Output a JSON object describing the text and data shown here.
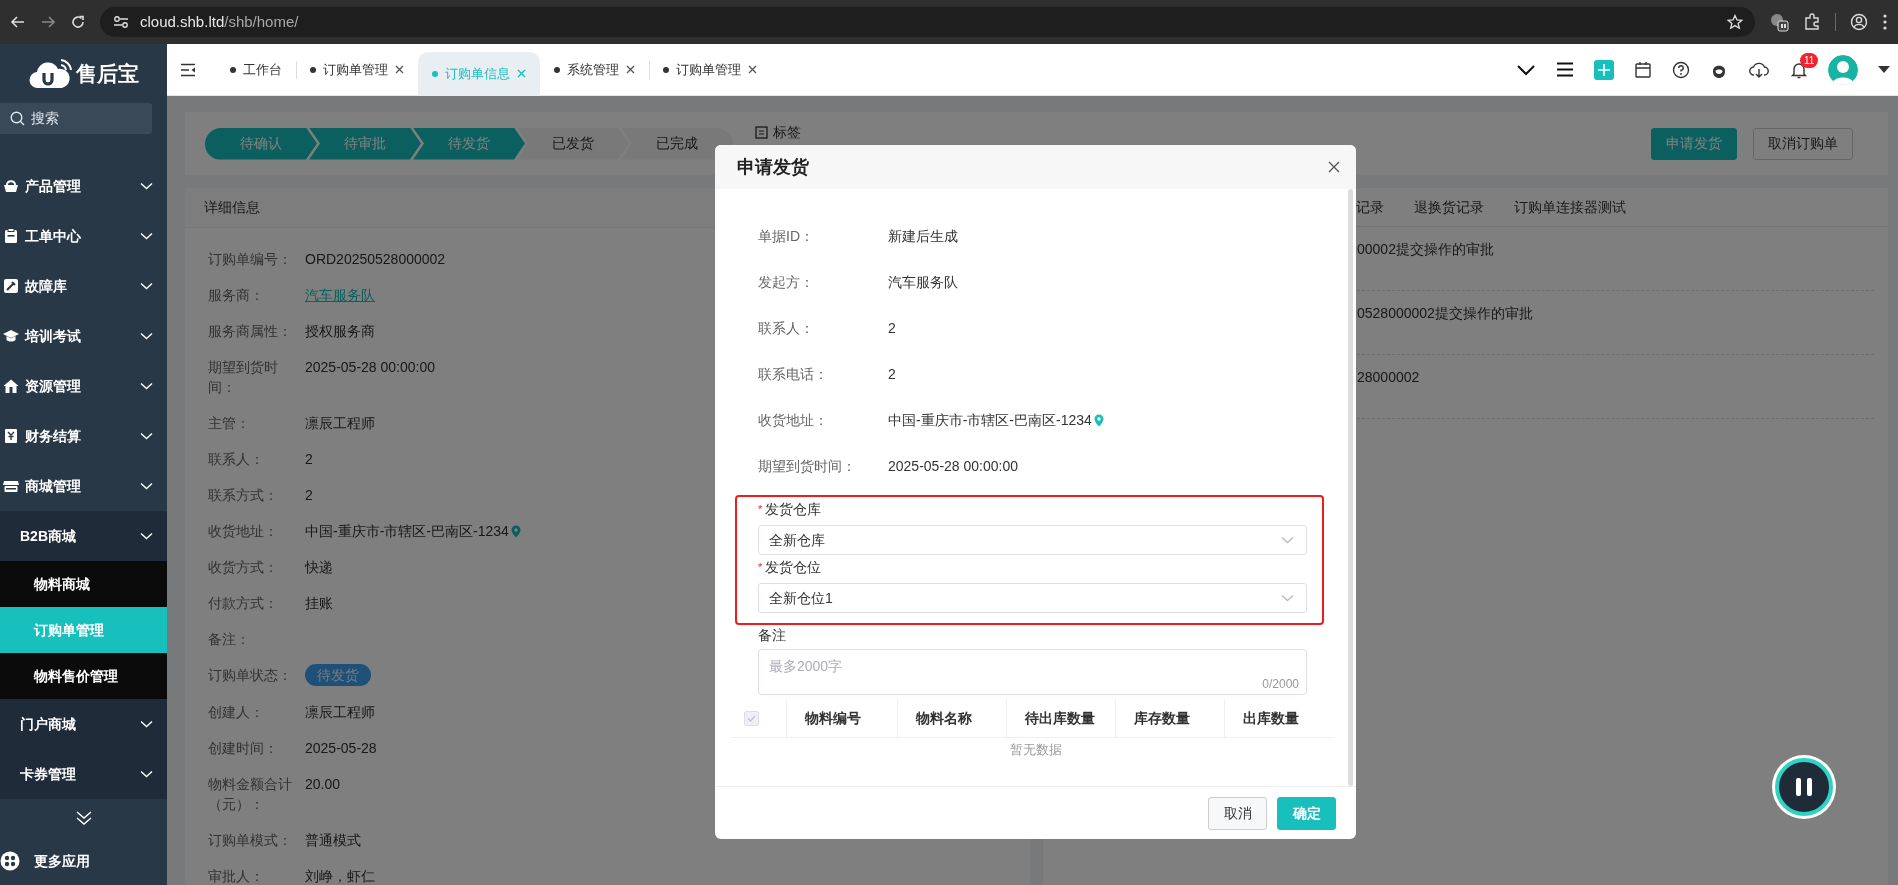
{
  "browser": {
    "url_host": "cloud.shb.ltd",
    "url_path": "/shb/home/"
  },
  "sidebar": {
    "logo_text": "售后宝",
    "search_placeholder": "搜索",
    "more_apps": "更多应用",
    "items": [
      {
        "label": "产品管理"
      },
      {
        "label": "工单中心"
      },
      {
        "label": "故障库"
      },
      {
        "label": "培训考试"
      },
      {
        "label": "资源管理"
      },
      {
        "label": "财务结算"
      },
      {
        "label": "商城管理",
        "expanded": true,
        "children": [
          {
            "label": "B2B商城",
            "expanded": true,
            "children": [
              {
                "label": "物料商城",
                "selected": false
              },
              {
                "label": "订购单管理",
                "selected": true
              },
              {
                "label": "物料售价管理",
                "selected": false
              }
            ]
          },
          {
            "label": "门户商城"
          },
          {
            "label": "卡券管理"
          }
        ]
      }
    ]
  },
  "tabs": [
    {
      "label": "工作台",
      "selected": false,
      "closable": false
    },
    {
      "label": "订购单管理",
      "selected": false,
      "closable": true
    },
    {
      "label": "订购单信息",
      "selected": true,
      "closable": true
    },
    {
      "label": "系统管理",
      "selected": false,
      "closable": true
    },
    {
      "label": "订购单管理",
      "selected": false,
      "closable": true
    }
  ],
  "header": {
    "notification_count": "11"
  },
  "steps": [
    {
      "label": "待确认",
      "done": true
    },
    {
      "label": "待审批",
      "done": true
    },
    {
      "label": "待发货",
      "done": true
    },
    {
      "label": "已发货",
      "done": false
    },
    {
      "label": "已完成",
      "done": false
    }
  ],
  "tag_label": "标签",
  "actions": [
    {
      "label": "申请发货",
      "kind": "primary"
    },
    {
      "label": "取消订购单",
      "kind": "secondary"
    }
  ],
  "detail": {
    "title": "详细信息",
    "rows": [
      {
        "label": "订购单编号：",
        "value": "ORD20250528000002",
        "kind": "text"
      },
      {
        "label": "服务商：",
        "value": "汽车服务队",
        "kind": "link"
      },
      {
        "label": "服务商属性：",
        "value": "授权服务商",
        "kind": "text"
      },
      {
        "label": "期望到货时间：",
        "value": "2025-05-28 00:00:00",
        "kind": "text"
      },
      {
        "label": "主管：",
        "value": "凛辰工程师",
        "kind": "text"
      },
      {
        "label": "联系人：",
        "value": "2",
        "kind": "text"
      },
      {
        "label": "联系方式：",
        "value": "2",
        "kind": "text"
      },
      {
        "label": "收货地址：",
        "value": "中国-重庆市-市辖区-巴南区-1234",
        "kind": "address"
      },
      {
        "label": "收货方式：",
        "value": "快递",
        "kind": "text"
      },
      {
        "label": "付款方式：",
        "value": "挂账",
        "kind": "text"
      },
      {
        "label": "备注：",
        "kind": "text"
      },
      {
        "label": "订购单状态：",
        "value": "待发货",
        "kind": "tag"
      },
      {
        "label": "创建人：",
        "value": "凛辰工程师",
        "kind": "text"
      },
      {
        "label": "创建时间：",
        "value": "2025-05-28",
        "kind": "text"
      },
      {
        "label": "物料金额合计（元）：",
        "value": "20.00",
        "kind": "text"
      },
      {
        "label": "订购单模式：",
        "value": "普通模式",
        "kind": "text"
      },
      {
        "label": "审批人：",
        "value": "刘峥，虾仁",
        "kind": "text"
      }
    ]
  },
  "record_tabs": [
    {
      "label": "记录",
      "selected": false
    },
    {
      "label": "退换货记录",
      "selected": false
    },
    {
      "label": "订购单连接器测试",
      "selected": false
    }
  ],
  "records": [
    "00002提交操作的审批",
    "0528000002提交操作的审批",
    "28000002"
  ],
  "dialog": {
    "title": "申请发货",
    "fields": [
      {
        "label": "单据ID：",
        "value": "新建后生成",
        "kind": "text"
      },
      {
        "label": "发起方：",
        "value": "汽车服务队",
        "kind": "text"
      },
      {
        "label": "联系人：",
        "value": "2",
        "kind": "text"
      },
      {
        "label": "联系电话：",
        "value": "2",
        "kind": "text"
      },
      {
        "label": "收货地址：",
        "value": "中国-重庆市-市辖区-巴南区-1234",
        "kind": "address"
      },
      {
        "label": "期望到货时间：",
        "value": "2025-05-28 00:00:00",
        "kind": "text"
      }
    ],
    "form": {
      "highlighted": true,
      "required_mark": "*",
      "selects": [
        {
          "label": "发货仓库",
          "required": true,
          "value": "全新仓库"
        },
        {
          "label": "发货仓位",
          "required": true,
          "value": "全新仓位1"
        }
      ]
    },
    "remark": {
      "label": "备注",
      "placeholder": "最多2000字",
      "counter": "0/2000"
    },
    "table": {
      "select_all": {
        "checked": true,
        "disabled": true
      },
      "columns": [
        "物料编号",
        "物料名称",
        "待出库数量",
        "库存数量",
        "出库数量"
      ],
      "empty_text": "暂无数据"
    },
    "buttons": [
      {
        "label": "取消",
        "kind": "secondary"
      },
      {
        "label": "确定",
        "kind": "primary"
      }
    ]
  }
}
